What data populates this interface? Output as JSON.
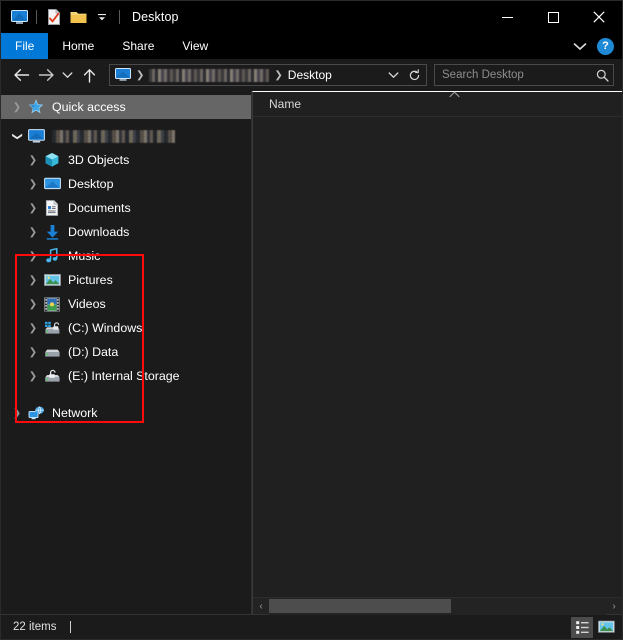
{
  "window": {
    "title": "Desktop",
    "quick_access_toolbar": [
      {
        "name": "explorer-icon",
        "label": "File Explorer"
      },
      {
        "name": "properties-icon",
        "label": "Properties"
      },
      {
        "name": "new-folder-icon",
        "label": "New folder"
      },
      {
        "name": "customize-qat-icon",
        "label": "Customize Quick Access Toolbar"
      }
    ],
    "controls": {
      "minimize": "Minimize",
      "maximize": "Maximize",
      "close": "Close"
    }
  },
  "ribbon": {
    "tabs": [
      {
        "label": "File",
        "active": true
      },
      {
        "label": "Home",
        "active": false
      },
      {
        "label": "Share",
        "active": false
      },
      {
        "label": "View",
        "active": false
      }
    ],
    "expand_label": "Expand the Ribbon",
    "help_label": "?"
  },
  "navbar": {
    "back_label": "Back",
    "forward_label": "Forward",
    "recent_label": "Recent locations",
    "up_label": "Up",
    "breadcrumb": {
      "root_icon": "this-pc-icon",
      "redacted_segment": "",
      "current": "Desktop"
    },
    "dropdown_label": "Previous locations",
    "refresh_label": "Refresh"
  },
  "search": {
    "placeholder": "Search Desktop",
    "value": "",
    "icon": "search-icon"
  },
  "sidebar": {
    "items": [
      {
        "label": "Quick access",
        "icon": "star-pin-icon",
        "level": 1,
        "expandable": true,
        "expanded": false,
        "selected": true
      },
      {
        "label": "",
        "icon": "this-pc-icon",
        "level": 1,
        "expandable": true,
        "expanded": true,
        "selected": false,
        "redacted": true
      },
      {
        "label": "3D Objects",
        "icon": "3d-objects-icon",
        "level": 2,
        "expandable": true,
        "expanded": false,
        "selected": false,
        "highlighted": true
      },
      {
        "label": "Desktop",
        "icon": "desktop-icon",
        "level": 2,
        "expandable": true,
        "expanded": false,
        "selected": false,
        "highlighted": true
      },
      {
        "label": "Documents",
        "icon": "documents-icon",
        "level": 2,
        "expandable": true,
        "expanded": false,
        "selected": false,
        "highlighted": true
      },
      {
        "label": "Downloads",
        "icon": "downloads-icon",
        "level": 2,
        "expandable": true,
        "expanded": false,
        "selected": false,
        "highlighted": true
      },
      {
        "label": "Music",
        "icon": "music-icon",
        "level": 2,
        "expandable": true,
        "expanded": false,
        "selected": false,
        "highlighted": true
      },
      {
        "label": "Pictures",
        "icon": "pictures-icon",
        "level": 2,
        "expandable": true,
        "expanded": false,
        "selected": false,
        "highlighted": true
      },
      {
        "label": "Videos",
        "icon": "videos-icon",
        "level": 2,
        "expandable": true,
        "expanded": false,
        "selected": false,
        "highlighted": true
      },
      {
        "label": "(C:) Windows",
        "icon": "windows-drive-icon",
        "level": 2,
        "expandable": true,
        "expanded": false,
        "selected": false
      },
      {
        "label": "(D:) Data",
        "icon": "drive-icon",
        "level": 2,
        "expandable": true,
        "expanded": false,
        "selected": false
      },
      {
        "label": "(E:) Internal Storage",
        "icon": "unlocked-drive-icon",
        "level": 2,
        "expandable": true,
        "expanded": false,
        "selected": false
      },
      {
        "label": "Network",
        "icon": "network-icon",
        "level": 1,
        "expandable": true,
        "expanded": false,
        "selected": false
      }
    ],
    "annotation": {
      "shape": "rectangle",
      "color": "#ff0b0b",
      "covers": [
        "3D Objects",
        "Desktop",
        "Documents",
        "Downloads",
        "Music",
        "Pictures",
        "Videos"
      ]
    }
  },
  "filepane": {
    "columns": [
      {
        "label": "Name",
        "sorted": "ascending",
        "sort_glyph": "^"
      }
    ],
    "rows": []
  },
  "scrollbar": {
    "left_arrow": "‹",
    "right_arrow": "›"
  },
  "statusbar": {
    "item_count": "22 items",
    "views": [
      {
        "name": "details-view-button",
        "label": "Details view",
        "active": true
      },
      {
        "name": "large-icons-view-button",
        "label": "Large icons view",
        "active": false
      }
    ]
  },
  "colors": {
    "accent": "#0078d7",
    "annotation_red": "#ff0b0b",
    "window_bg": "#1b1b1b",
    "pane_bg": "#202020",
    "selection_gray": "#666666"
  }
}
